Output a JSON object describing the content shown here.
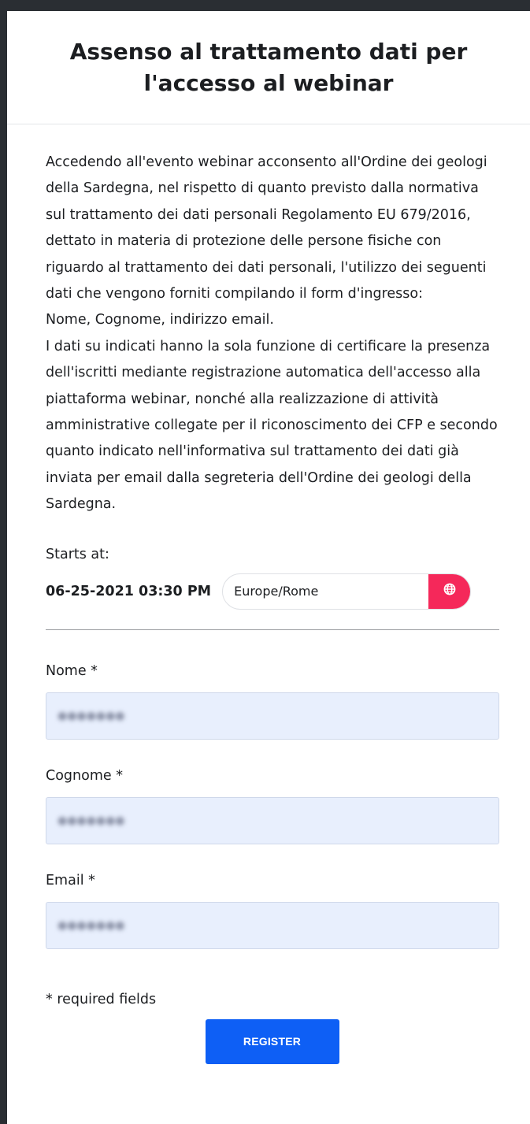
{
  "header": {
    "title": "Assenso al trattamento dati per l'accesso al webinar"
  },
  "consent": {
    "text": "Accedendo all'evento webinar acconsento all'Ordine dei geologi della Sardegna, nel rispetto di quanto previsto dalla normativa sul trattamento dei dati personali Regolamento EU 679/2016, dettato in materia di protezione delle persone fisiche con riguardo al trattamento dei dati personali, l'utilizzo dei seguenti dati che vengono forniti compilando il form d'ingresso:\nNome, Cognome, indirizzo email.\nI dati su indicati hanno la sola funzione di certificare la presenza dell'iscritti mediante registrazione automatica dell'accesso alla piattaforma webinar, nonché alla realizzazione di attività amministrative collegate per il riconoscimento dei CFP e secondo quanto indicato nell'informativa sul trattamento dei dati già inviata per email dalla segreteria dell'Ordine dei geologi della Sardegna."
  },
  "schedule": {
    "label": "Starts at:",
    "datetime": "06-25-2021 03:30 PM",
    "timezone": "Europe/Rome",
    "timezone_icon": "globe-icon",
    "accent_color": "#f5285a"
  },
  "form": {
    "fields": [
      {
        "label": "Nome *"
      },
      {
        "label": "Cognome *"
      },
      {
        "label": "Email *"
      }
    ],
    "required_note": "* required fields",
    "submit_label": "REGISTER",
    "submit_color": "#0e5ff5",
    "input_bg": "#e8effd"
  }
}
